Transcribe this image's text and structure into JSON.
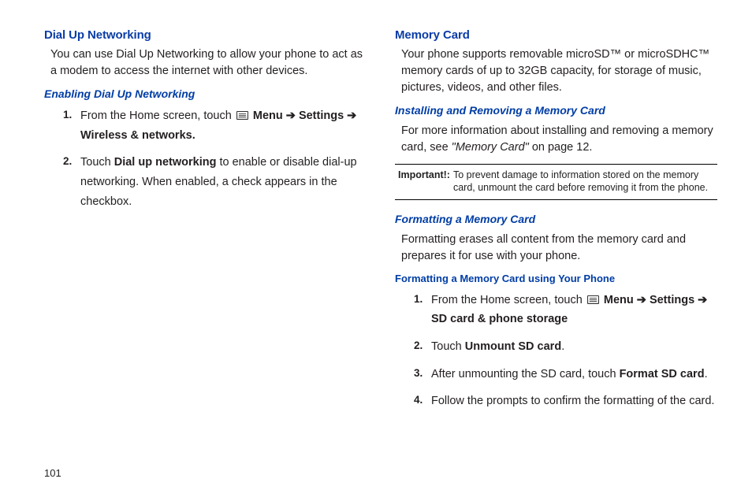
{
  "pageNumber": "101",
  "left": {
    "h1": "Dial Up Networking",
    "p1": "You can use Dial Up Networking to allow your phone to act as a modem to access the internet with other devices.",
    "h_sub": "Enabling Dial Up Networking",
    "step1_a": "From the Home screen, touch ",
    "step1_menu": "Menu",
    "step1_arrow1": " ➔ ",
    "step1_settings": "Settings",
    "step1_arrow2": " ➔ ",
    "step1_wireless": "Wireless & networks.",
    "step2_a": "Touch ",
    "step2_b": "Dial up networking",
    "step2_c": " to enable or disable dial-up networking. When enabled, a check appears in the checkbox."
  },
  "right": {
    "h1": "Memory Card",
    "p1": "Your phone supports removable microSD™ or microSDHC™ memory cards of up to 32GB capacity, for storage of music, pictures, videos, and other files.",
    "h_sub1": "Installing and Removing a Memory Card",
    "p2_a": "For more information about installing and removing a memory card, see ",
    "p2_ref": "\"Memory Card\"",
    "p2_b": " on page 12.",
    "important_label": "Important!:",
    "important_text": "To prevent damage to information stored on the memory card, unmount the card before removing it from the phone.",
    "h_sub2": "Formatting a Memory Card",
    "p3": "Formatting erases all content from the memory card and prepares it for use with your phone.",
    "h_sub3": "Formatting a Memory Card using Your Phone",
    "step1_a": "From the Home screen, touch ",
    "step1_menu": "Menu",
    "step1_arrow1": " ➔ ",
    "step1_settings": "Settings",
    "step1_arrow2": " ➔ ",
    "step1_sd": "SD card & phone storage",
    "step2_a": "Touch ",
    "step2_b": "Unmount SD card",
    "step2_c": ".",
    "step3_a": "After unmounting the SD card, touch ",
    "step3_b": "Format SD card",
    "step3_c": ".",
    "step4": "Follow the prompts to confirm the formatting of the card."
  }
}
